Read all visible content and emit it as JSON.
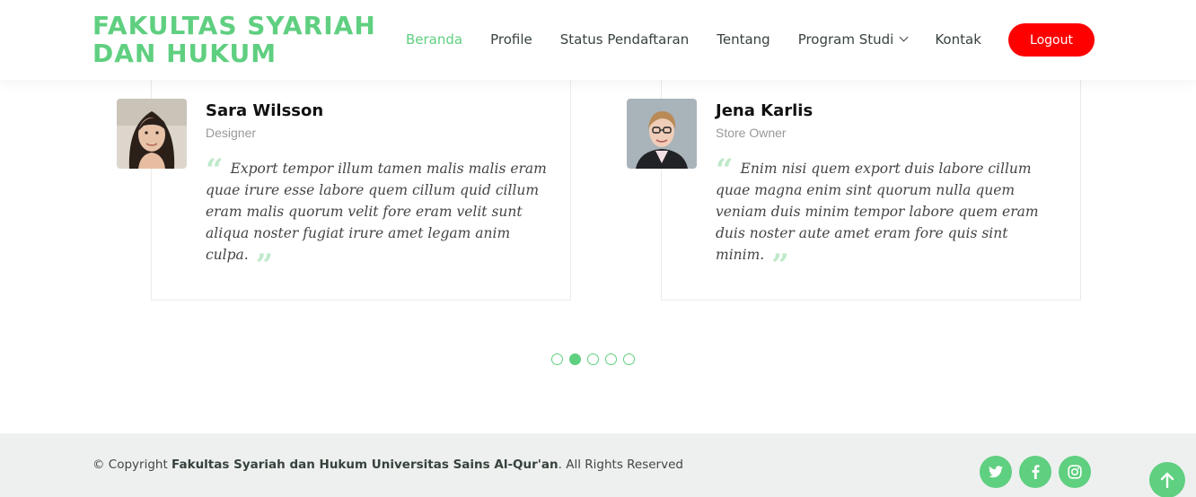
{
  "header": {
    "logo_line1": "FAKULTAS SYARIAH",
    "logo_line2": "DAN HUKUM",
    "nav": {
      "beranda": "Beranda",
      "profile": "Profile",
      "status": "Status Pendaftaran",
      "tentang": "Tentang",
      "program": "Program Studi",
      "kontak": "Kontak"
    },
    "logout": "Logout"
  },
  "testimonials": [
    {
      "name": "Sara Wilsson",
      "role": "Designer",
      "quote": "Export tempor illum tamen malis malis eram quae irure esse labore quem cillum quid cillum eram malis quorum velit fore eram velit sunt aliqua noster fugiat irure amet legam anim culpa."
    },
    {
      "name": "Jena Karlis",
      "role": "Store Owner",
      "quote": "Enim nisi quem export duis labore cillum quae magna enim sint quorum nulla quem veniam duis minim tempor labore quem eram duis noster aute amet eram fore quis sint minim."
    }
  ],
  "quote_open": "“",
  "quote_close": "”",
  "carousel": {
    "total": 5,
    "active_index": 2
  },
  "footer": {
    "copyright_prefix": "© Copyright ",
    "copyright_org": "Fakultas Syariah dan Hukum Universitas Sains Al-Qur'an",
    "copyright_suffix": ". All Rights Reserved",
    "social_icons": [
      "twitter-icon",
      "facebook-icon",
      "instagram-icon"
    ]
  },
  "colors": {
    "accent": "#5fcf80",
    "logout": "#ff0000",
    "footer_bg": "#eef0ef"
  }
}
